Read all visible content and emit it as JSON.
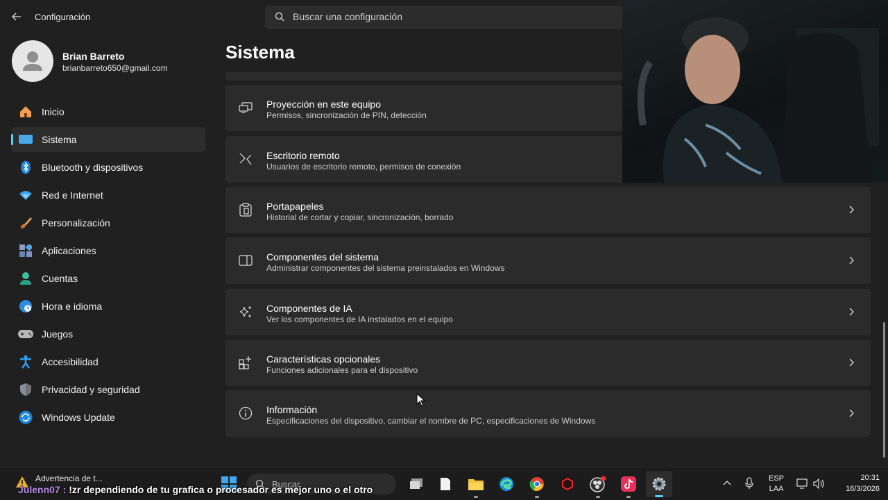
{
  "window": {
    "title": "Configuración",
    "search_placeholder": "Buscar una configuración"
  },
  "profile": {
    "name": "Brian Barreto",
    "email": "brianbarreto650@gmail.com"
  },
  "sidebar": {
    "items": [
      {
        "label": "Inicio",
        "icon": "home-icon"
      },
      {
        "label": "Sistema",
        "icon": "system-icon",
        "active": true
      },
      {
        "label": "Bluetooth y dispositivos",
        "icon": "bluetooth-icon"
      },
      {
        "label": "Red e Internet",
        "icon": "wifi-icon"
      },
      {
        "label": "Personalización",
        "icon": "brush-icon"
      },
      {
        "label": "Aplicaciones",
        "icon": "apps-icon"
      },
      {
        "label": "Cuentas",
        "icon": "account-icon"
      },
      {
        "label": "Hora e idioma",
        "icon": "clock-globe-icon"
      },
      {
        "label": "Juegos",
        "icon": "gamepad-icon"
      },
      {
        "label": "Accesibilidad",
        "icon": "accessibility-icon"
      },
      {
        "label": "Privacidad y seguridad",
        "icon": "shield-icon"
      },
      {
        "label": "Windows Update",
        "icon": "update-icon"
      }
    ]
  },
  "main": {
    "title": "Sistema",
    "cards": [
      {
        "title": "Proyección en este equipo",
        "subtitle": "Permisos, sincronización de PIN, detección",
        "icon": "projection-icon"
      },
      {
        "title": "Escritorio remoto",
        "subtitle": "Usuarios de escritorio remoto, permisos de conexión",
        "icon": "remote-desktop-icon"
      },
      {
        "title": "Portapapeles",
        "subtitle": "Historial de cortar y copiar, sincronización, borrado",
        "icon": "clipboard-icon"
      },
      {
        "title": "Componentes del sistema",
        "subtitle": "Administrar componentes del sistema preinstalados en Windows",
        "icon": "system-components-icon"
      },
      {
        "title": "Componentes de IA",
        "subtitle": "Ver los componentes de IA instalados en el equipo",
        "icon": "sparkle-icon"
      },
      {
        "title": "Características opcionales",
        "subtitle": "Funciones adicionales para el dispositivo",
        "icon": "optional-features-icon"
      },
      {
        "title": "Información",
        "subtitle": "Especificaciones del dispositivo, cambiar el nombre de PC, especificaciones de Windows",
        "icon": "info-icon"
      }
    ]
  },
  "taskbar": {
    "notification_title": "Advertencia de t...",
    "search_label": "Buscar",
    "lang_top": "ESP",
    "lang_bottom": "LAA",
    "time": "20:31",
    "date": "16/3/2026"
  },
  "chat_overlay": {
    "user": "Julenn07 :",
    "message": "!zr dependiendo de tu grafica o procesador es mejor uno o el otro"
  },
  "colors": {
    "background": "#202020",
    "card": "#2b2b2b",
    "accent": "#60cdff"
  }
}
